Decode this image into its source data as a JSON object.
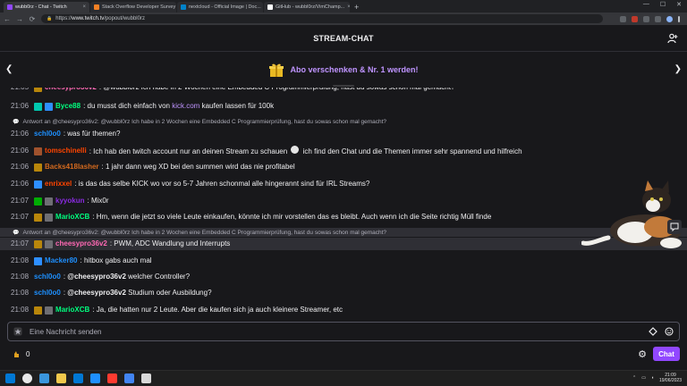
{
  "browser": {
    "tabs": [
      {
        "title": "wubb0rz - Chat - Twitch",
        "fav_color": "#9147ff"
      },
      {
        "title": "Stack Overflow Developer Survey",
        "fav_color": "#f48024"
      },
      {
        "title": "nextcloud - Official Image | Doc...",
        "fav_color": "#0082c9"
      },
      {
        "title": "GitHub - wubbl0rz/VimChamp...",
        "fav_color": "#ffffff"
      }
    ],
    "new_tab": "+",
    "url_prefix": "https://",
    "url_host": "www.twitch.tv",
    "url_path": "/popout/wubbl0rz",
    "nav": [
      "←",
      "→",
      "⟳"
    ]
  },
  "header": {
    "title": "STREAM-CHAT"
  },
  "gift": {
    "text": "Abo verschenken & Nr. 1 werden!"
  },
  "chat": {
    "messages": [
      {
        "type": "msg",
        "ts": "21:06",
        "user": "Byce88",
        "user_color": "#00ff7f",
        "badges": [
          "#00c8af",
          "#2e8fff"
        ],
        "parts": [
          {
            "t": ": du musst dich einfach von "
          },
          {
            "l": "kick.com"
          },
          {
            "t": " kaufen lassen für 100k"
          }
        ]
      },
      {
        "type": "reply",
        "text": "Antwort an @cheesypro36v2: @wubbl0rz Ich habe in 2 Wochen eine Embedded C Programmierprüfung, hast du sowas schon mal gemacht?"
      },
      {
        "type": "msg",
        "ts": "21:06",
        "user": "schl0o0",
        "user_color": "#1e90ff",
        "badges": [],
        "parts": [
          {
            "t": ": was für themen?"
          }
        ]
      },
      {
        "type": "msg",
        "ts": "21:06",
        "user": "tomschinelli",
        "user_color": "#ff4500",
        "badges": [
          "#a0522d"
        ],
        "parts": [
          {
            "t": ": Ich hab den twitch account nur an deinen Stream zu schauen "
          },
          {
            "e": "emote"
          },
          {
            "t": " ich find den Chat und die Themen immer sehr spannend und hilfreich"
          }
        ]
      },
      {
        "type": "msg",
        "ts": "21:06",
        "user": "Backs418lasher",
        "user_color": "#d2691e",
        "badges": [
          "#b8860b"
        ],
        "parts": [
          {
            "t": ": 1 jahr dann weg XD bei den summen wird das nie profitabel"
          }
        ]
      },
      {
        "type": "msg",
        "ts": "21:06",
        "user": "enrixxel",
        "user_color": "#ff4500",
        "badges": [
          "#2e8fff"
        ],
        "parts": [
          {
            "t": ": is das das selbe KICK wo vor so 5-7 Jahren schonmal alle hingerannt sind für IRL Streams?"
          }
        ]
      },
      {
        "type": "msg",
        "ts": "21:07",
        "user": "kyyokun",
        "user_color": "#8a2be2",
        "badges": [
          "#00ad03",
          "#6e6e73"
        ],
        "parts": [
          {
            "t": ": Mix0r"
          }
        ]
      },
      {
        "type": "msg",
        "ts": "21:07",
        "user": "MarioXCB",
        "user_color": "#00ff7f",
        "badges": [
          "#b8860b",
          "#6e6e73"
        ],
        "parts": [
          {
            "t": ": Hm, wenn die jetzt so viele Leute einkaufen, könnte ich mir vorstellen das es bleibt. Auch wenn ich die Seite richtig Müll finde"
          }
        ]
      },
      {
        "type": "reply",
        "hl": true,
        "text": "Antwort an @cheesypro36v2: @wubbl0rz Ich habe in 2 Wochen eine Embedded C Programmierprüfung, hast du sowas schon mal gemacht?"
      },
      {
        "type": "msg",
        "hl": true,
        "ts": "21:07",
        "user": "cheesypro36v2",
        "user_color": "#ff69b4",
        "badges": [
          "#b8860b",
          "#6e6e73"
        ],
        "parts": [
          {
            "t": ": PWM, ADC Wandlung und Interrupts"
          }
        ]
      },
      {
        "type": "msg",
        "ts": "21:08",
        "user": "Macker80",
        "user_color": "#1e90ff",
        "badges": [
          "#2e8fff"
        ],
        "parts": [
          {
            "t": ": hitbox gabs auch mal"
          }
        ]
      },
      {
        "type": "msg",
        "ts": "21:08",
        "user": "schl0o0",
        "user_color": "#1e90ff",
        "badges": [],
        "parts": [
          {
            "t": ": "
          },
          {
            "m": "@cheesypro36v2"
          },
          {
            "t": " welcher Controller?"
          }
        ]
      },
      {
        "type": "msg",
        "ts": "21:08",
        "user": "schl0o0",
        "user_color": "#1e90ff",
        "badges": [],
        "parts": [
          {
            "t": ": "
          },
          {
            "m": "@cheesypro36v2"
          },
          {
            "t": " Studium oder Ausbildung?"
          }
        ]
      },
      {
        "type": "msg",
        "ts": "21:08",
        "user": "MarioXCB",
        "user_color": "#00ff7f",
        "badges": [
          "#b8860b",
          "#6e6e73"
        ],
        "parts": [
          {
            "t": ": Ja, die hatten nur 2 Leute. Aber die kaufen sich ja auch kleinere Streamer, etc"
          }
        ]
      }
    ]
  },
  "input": {
    "placeholder": "Eine Nachricht senden"
  },
  "bits": {
    "count": "0"
  },
  "chat_button": "Chat",
  "taskbar": {
    "icons": [
      "#0078d4",
      "#e8e8e8",
      "#3a96dd",
      "#f2c94c",
      "#0078d4",
      "#1e90ff",
      "#ff3b30",
      "#4285f4",
      "#d9d9d9"
    ],
    "time": "21:09",
    "date": "19/06/2023"
  },
  "colors": {
    "accent": "#9147ff",
    "highlight": "#bf94ff",
    "bg": "#18181b"
  }
}
